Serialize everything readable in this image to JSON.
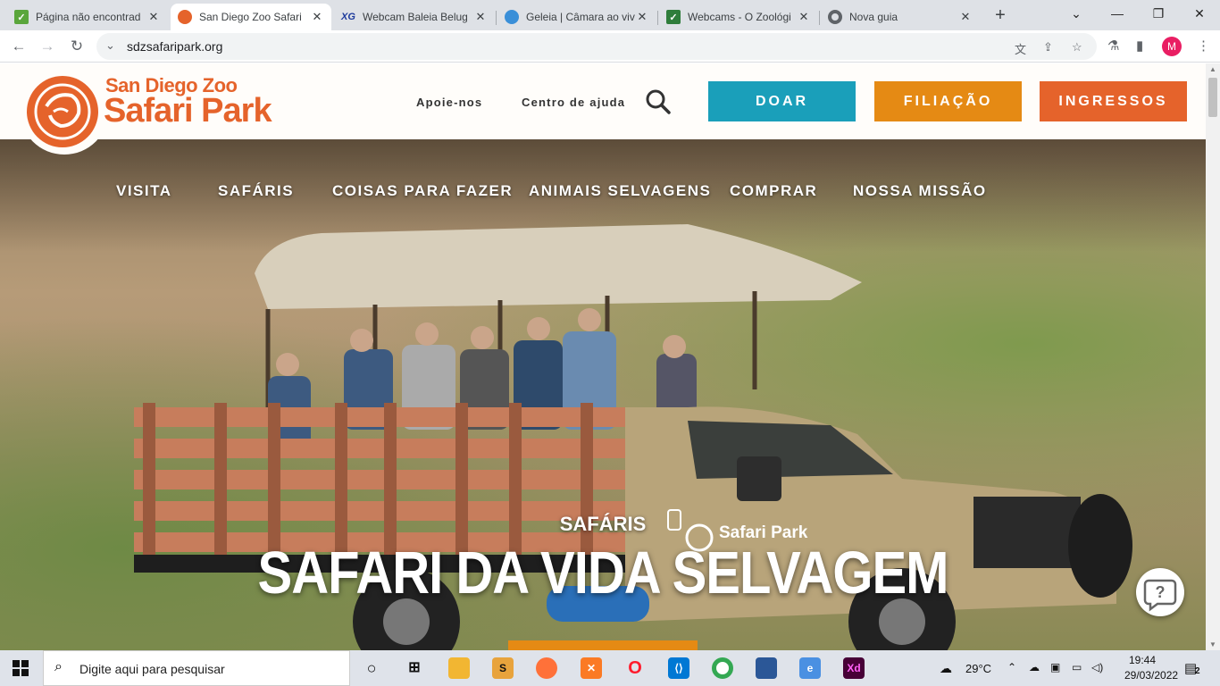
{
  "browser": {
    "tabs": [
      {
        "title": "Página não encontrad",
        "icon": "leaf-favicon-icon",
        "active": false
      },
      {
        "title": "San Diego Zoo Safari",
        "icon": "safari-park-favicon-icon",
        "active": true
      },
      {
        "title": "Webcam Baleia Belug",
        "icon": "xg-favicon-icon",
        "active": false
      },
      {
        "title": "Geleia | Câmara ao viv",
        "icon": "globe-favicon-icon",
        "active": false
      },
      {
        "title": "Webcams - O Zoológi",
        "icon": "leaf-favicon-icon",
        "active": false
      },
      {
        "title": "Nova guia",
        "icon": "chrome-icon",
        "active": false
      }
    ],
    "new_tab": "+",
    "address": "sdzsafaripark.org",
    "profile_initial": "M"
  },
  "site": {
    "logo_line1": "San Diego Zoo",
    "logo_line2": "Safari Park",
    "utility_links": [
      "Apoie-nos",
      "Centro de ajuda"
    ],
    "cta_buttons": [
      {
        "label": "DOAR",
        "color": "#1a9fba"
      },
      {
        "label": "FILIAÇÃO",
        "color": "#e58a14"
      },
      {
        "label": "INGRESSOS",
        "color": "#e5632b"
      }
    ],
    "main_nav": [
      "VISITA",
      "SAFÁRIS",
      "COISAS PARA FAZER",
      "ANIMAIS SELVAGENS",
      "COMPRAR",
      "NOSSA MISSÃO"
    ],
    "hero": {
      "kicker": "SAFÁRIS",
      "title": "SAFARI DA VIDA SELVAGEM",
      "truck_logo": "Safari Park"
    },
    "help_icon": "?"
  },
  "taskbar": {
    "search_placeholder": "Digite aqui para pesquisar",
    "weather": "29°C",
    "time": "19:44",
    "date": "29/03/2022",
    "notifications": "2"
  },
  "colors": {
    "brand_orange": "#e5632b",
    "donate_teal": "#1a9fba",
    "member_amber": "#e58a14"
  }
}
